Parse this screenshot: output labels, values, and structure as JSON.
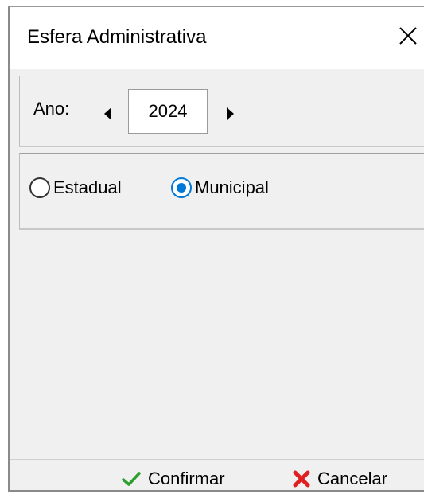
{
  "window": {
    "title": "Esfera Administrativa"
  },
  "year_selector": {
    "label": "Ano:",
    "value": "2024"
  },
  "scope": {
    "options": [
      {
        "label": "Estadual",
        "selected": false
      },
      {
        "label": "Municipal",
        "selected": true
      }
    ]
  },
  "footer": {
    "confirm_label": "Confirmar",
    "cancel_label": "Cancelar"
  },
  "colors": {
    "accent": "#0078d7",
    "confirm_icon": "#2e9e2e",
    "cancel_icon": "#e02020"
  },
  "icons": {
    "close": "close-icon",
    "prev": "triangle-left-icon",
    "next": "triangle-right-icon",
    "confirm": "checkmark-icon",
    "cancel": "x-mark-icon"
  }
}
